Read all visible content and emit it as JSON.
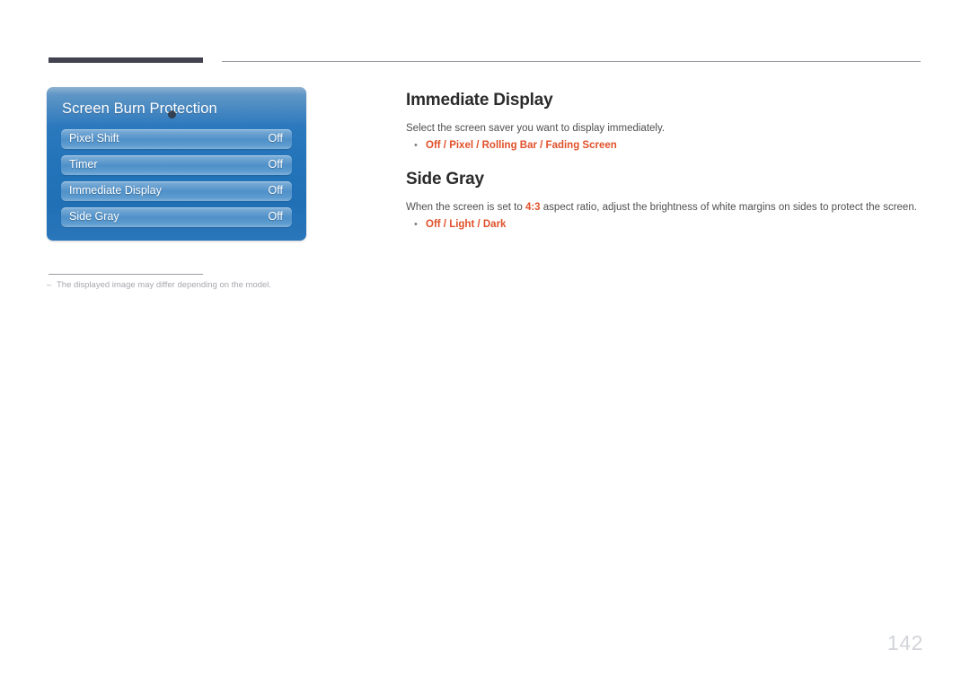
{
  "page": {
    "number": "142",
    "footnote_dash": "–",
    "footnote": "The displayed image may differ depending on the model."
  },
  "osd_panel": {
    "title": "Screen Burn Protection",
    "rows": [
      {
        "label": "Pixel Shift",
        "value": "Off"
      },
      {
        "label": "Timer",
        "value": "Off"
      },
      {
        "label": "Immediate Display",
        "value": "Off"
      },
      {
        "label": "Side Gray",
        "value": "Off"
      }
    ]
  },
  "sections": [
    {
      "title": "Immediate Display",
      "description": "Select the screen saver you want to display immediately.",
      "bullet_marker": "•",
      "options": "Off / Pixel / Rolling Bar / Fading Screen"
    },
    {
      "title": "Side Gray",
      "description_before": "When the screen is set to ",
      "description_highlight": "4:3",
      "description_after": " aspect ratio, adjust the brightness of white margins on sides to protect the screen.",
      "bullet_marker": "•",
      "options": "Off / Light / Dark"
    }
  ],
  "colors": {
    "accent_orange": "#e0502a",
    "panel_blue": "#2273b9",
    "rule_dark": "#434251",
    "page_number_gray": "#d2d4d9"
  }
}
